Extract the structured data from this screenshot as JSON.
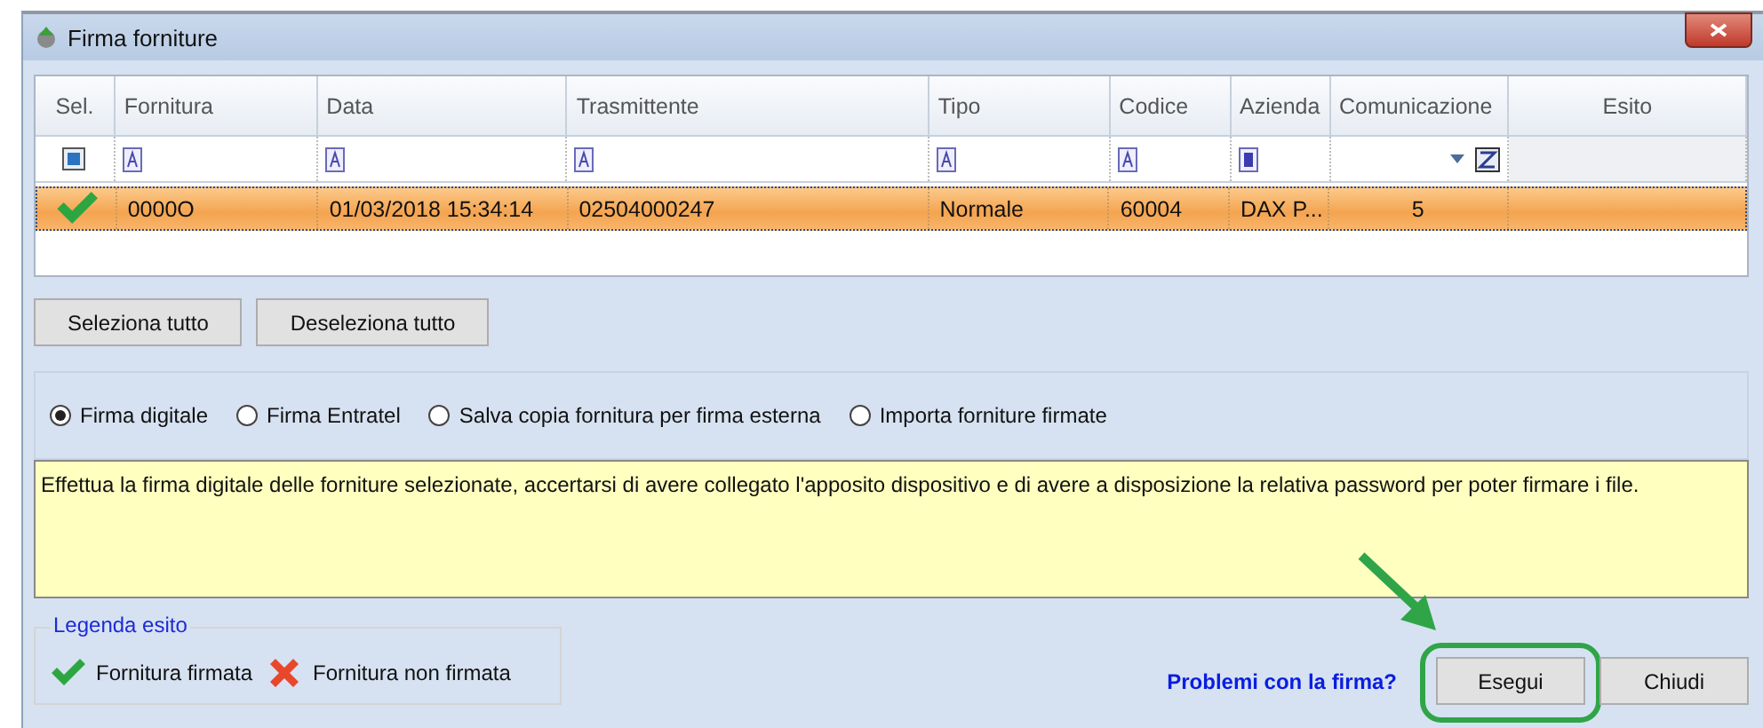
{
  "window": {
    "title": "Firma forniture"
  },
  "table": {
    "columns": [
      "Sel.",
      "Fornitura",
      "Data",
      "Trasmittente",
      "Tipo",
      "Codice",
      "Azienda",
      "Comunicazione",
      "Esito"
    ],
    "filters": [
      {
        "kind": "checkbox"
      },
      {
        "kind": "text"
      },
      {
        "kind": "text"
      },
      {
        "kind": "text"
      },
      {
        "kind": "text"
      },
      {
        "kind": "text"
      },
      {
        "kind": "list"
      },
      {
        "kind": "dropdown"
      },
      {
        "kind": "none"
      }
    ],
    "rows": [
      {
        "selected": true,
        "checked": true,
        "cells": [
          "",
          "0000O",
          "01/03/2018 15:34:14",
          "02504000247",
          "Normale",
          "60004",
          "DAX P...",
          "5"
        ]
      }
    ]
  },
  "selection_buttons": [
    "Seleziona tutto",
    "Deseleziona tutto"
  ],
  "modes": [
    {
      "label": "Firma digitale",
      "selected": true
    },
    {
      "label": "Firma Entratel",
      "selected": false
    },
    {
      "label": "Salva copia fornitura per firma esterna",
      "selected": false
    },
    {
      "label": "Importa forniture firmate",
      "selected": false
    }
  ],
  "description": "Effettua la firma digitale delle forniture selezionate, accertarsi di avere collegato l'apposito dispositivo e di avere a disposizione la relativa password per poter firmare i file.",
  "legend": {
    "title": "Legenda esito",
    "items": [
      {
        "kind": "signed",
        "label": "Fornitura firmata"
      },
      {
        "kind": "unsigned",
        "label": "Fornitura non firmata"
      }
    ]
  },
  "help_link": "Problemi con la firma?",
  "buttons": [
    {
      "label": "Esegui",
      "highlighted": true
    },
    {
      "label": "Chiudi",
      "highlighted": false
    }
  ]
}
